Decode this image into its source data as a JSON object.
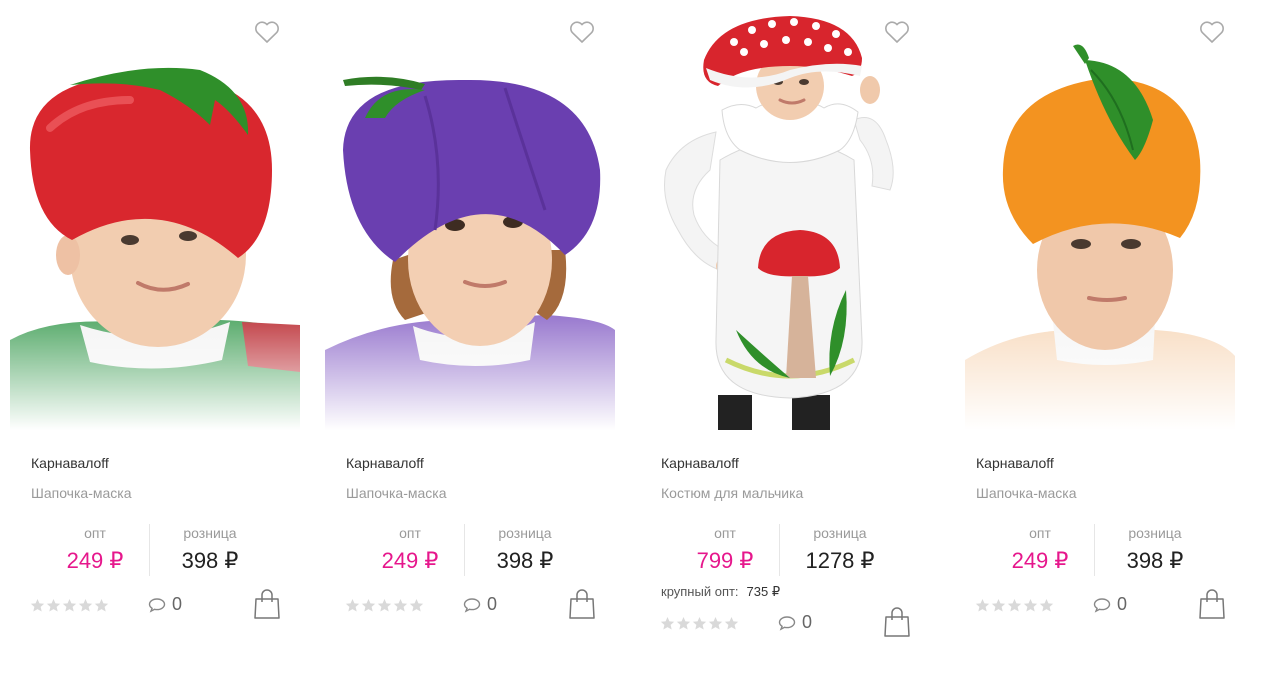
{
  "products": [
    {
      "brand": "Карнавалoff",
      "title": "Шапочка-маска",
      "opt_label": "опт",
      "opt_price": "249 ₽",
      "retail_label": "розница",
      "retail_price": "398 ₽",
      "comments": "0",
      "rating": 0,
      "bulk_label": "",
      "bulk_price": "",
      "image": "tomato-hat"
    },
    {
      "brand": "Карнавалoff",
      "title": "Шапочка-маска",
      "opt_label": "опт",
      "opt_price": "249 ₽",
      "retail_label": "розница",
      "retail_price": "398 ₽",
      "comments": "0",
      "rating": 0,
      "bulk_label": "",
      "bulk_price": "",
      "image": "plum-hat"
    },
    {
      "brand": "Карнавалoff",
      "title": "Костюм для мальчика",
      "opt_label": "опт",
      "opt_price": "799 ₽",
      "retail_label": "розница",
      "retail_price": "1278 ₽",
      "comments": "0",
      "rating": 0,
      "bulk_label": "крупный опт:",
      "bulk_price": "735 ₽",
      "image": "mushroom-costume"
    },
    {
      "brand": "Карнавалoff",
      "title": "Шапочка-маска",
      "opt_label": "опт",
      "opt_price": "249 ₽",
      "retail_label": "розница",
      "retail_price": "398 ₽",
      "comments": "0",
      "rating": 0,
      "bulk_label": "",
      "bulk_price": "",
      "image": "orange-hat"
    }
  ],
  "colors": {
    "accent_opt_price": "#e6178c",
    "muted_text": "#9a9a9a",
    "star_empty": "#d9d9d9",
    "tomato": "#d9272e",
    "plum": "#6a3fb0",
    "amanita": "#d8252d",
    "orange": "#f39320"
  }
}
